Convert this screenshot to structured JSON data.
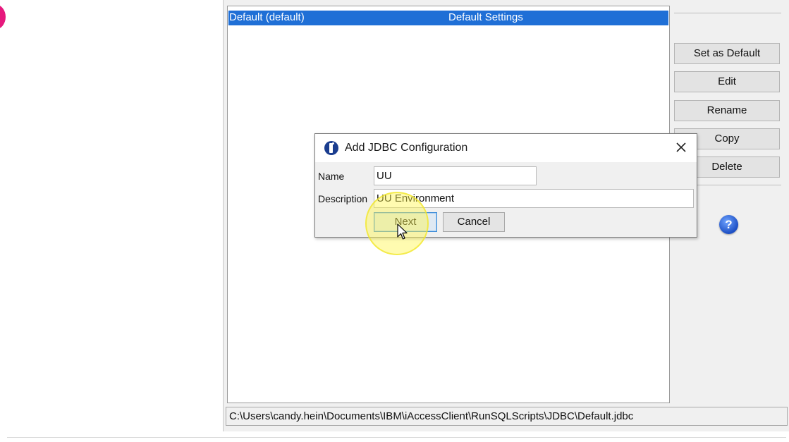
{
  "config_list": {
    "rows": [
      {
        "name": "Default (default)",
        "description": "Default Settings"
      }
    ]
  },
  "side_buttons": {
    "set_default": "Set as Default",
    "edit": "Edit",
    "rename": "Rename",
    "copy": "Copy",
    "delete": "Delete"
  },
  "help_icon": {
    "glyph": "?"
  },
  "path_field": {
    "value": "C:\\Users\\candy.hein\\Documents\\IBM\\iAccessClient\\RunSQLScripts\\JDBC\\Default.jdbc"
  },
  "dialog": {
    "title": "Add JDBC Configuration",
    "name_label": "Name",
    "name_value": "UU",
    "description_label": "Description",
    "description_value": "UU Environment",
    "next_label": "Next",
    "cancel_label": "Cancel"
  },
  "colors": {
    "selection": "#1f6fd6",
    "click_highlight": "#fff750",
    "help_icon": "#1d4fc4",
    "left_marker": "#e6197d"
  }
}
